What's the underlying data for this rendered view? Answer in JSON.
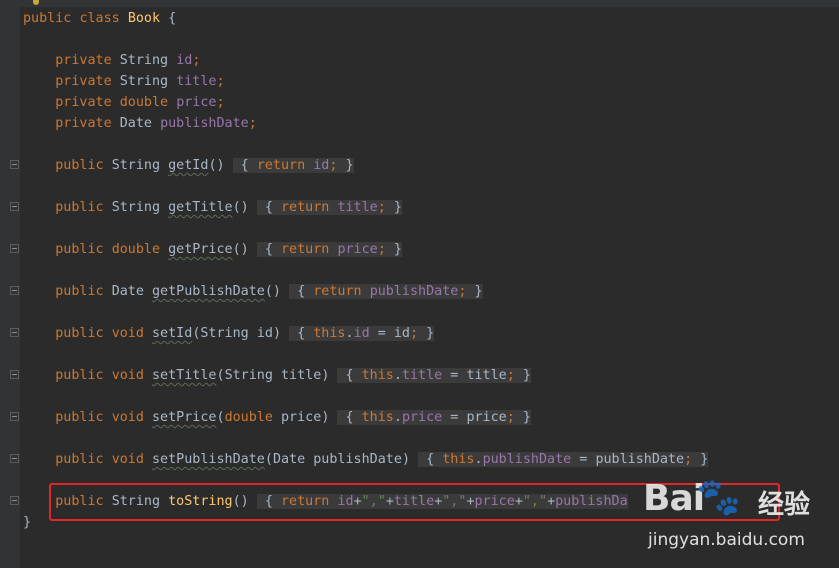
{
  "code": {
    "class_decl": {
      "kw_public": "public",
      "kw_class": "class",
      "name": "Book",
      "open": "{"
    },
    "fields": [
      {
        "mod": "private",
        "type": "String",
        "name": "id"
      },
      {
        "mod": "private",
        "type": "String",
        "name": "title"
      },
      {
        "mod": "private",
        "type": "double",
        "name": "price"
      },
      {
        "mod": "private",
        "type": "Date",
        "name": "publishDate"
      }
    ],
    "methods": {
      "getId": {
        "mod": "public",
        "type": "String",
        "name": "getId",
        "params": "()",
        "body_ret": "return",
        "body_val": "id"
      },
      "getTitle": {
        "mod": "public",
        "type": "String",
        "name": "getTitle",
        "params": "()",
        "body_ret": "return",
        "body_val": "title"
      },
      "getPrice": {
        "mod": "public",
        "type": "double",
        "name": "getPrice",
        "params": "()",
        "body_ret": "return",
        "body_val": "price"
      },
      "getPublishDate": {
        "mod": "public",
        "type": "Date",
        "name": "getPublishDate",
        "params": "()",
        "body_ret": "return",
        "body_val": "publishDate"
      },
      "setId": {
        "mod": "public",
        "type": "void",
        "name": "setId",
        "param_type": "String",
        "param_name": "id",
        "this": "this",
        "field": "id",
        "value": "id"
      },
      "setTitle": {
        "mod": "public",
        "type": "void",
        "name": "setTitle",
        "param_type": "String",
        "param_name": "title",
        "this": "this",
        "field": "title",
        "value": "title"
      },
      "setPrice": {
        "mod": "public",
        "type": "void",
        "name": "setPrice",
        "param_type": "double",
        "param_name": "price",
        "this": "this",
        "field": "price",
        "value": "price"
      },
      "setPublishDate": {
        "mod": "public",
        "type": "void",
        "name": "setPublishDate",
        "param_type": "Date",
        "param_name": "publishDate",
        "this": "this",
        "field": "publishDate",
        "value": "publishDate"
      },
      "toString": {
        "mod": "public",
        "type": "String",
        "name": "toString",
        "params": "()",
        "body_ret": "return",
        "expr": [
          "id",
          "+",
          "\",\"",
          "+",
          "title",
          "+",
          "\",\"",
          "+",
          "price",
          "+",
          "\",\"",
          "+",
          "publishDa"
        ]
      }
    },
    "class_close": "}"
  },
  "watermark": {
    "brand": "Bai",
    "paw": "🐾",
    "du": "du",
    "cn": "经验",
    "url": "jingyan.baidu.com"
  },
  "colors": {
    "background": "#2b2b2b",
    "keyword": "#cc7832",
    "field": "#9876aa",
    "method": "#ffc66d",
    "string": "#6a8759",
    "default_text": "#a9b7c6",
    "highlight_box": "#e0282b"
  }
}
